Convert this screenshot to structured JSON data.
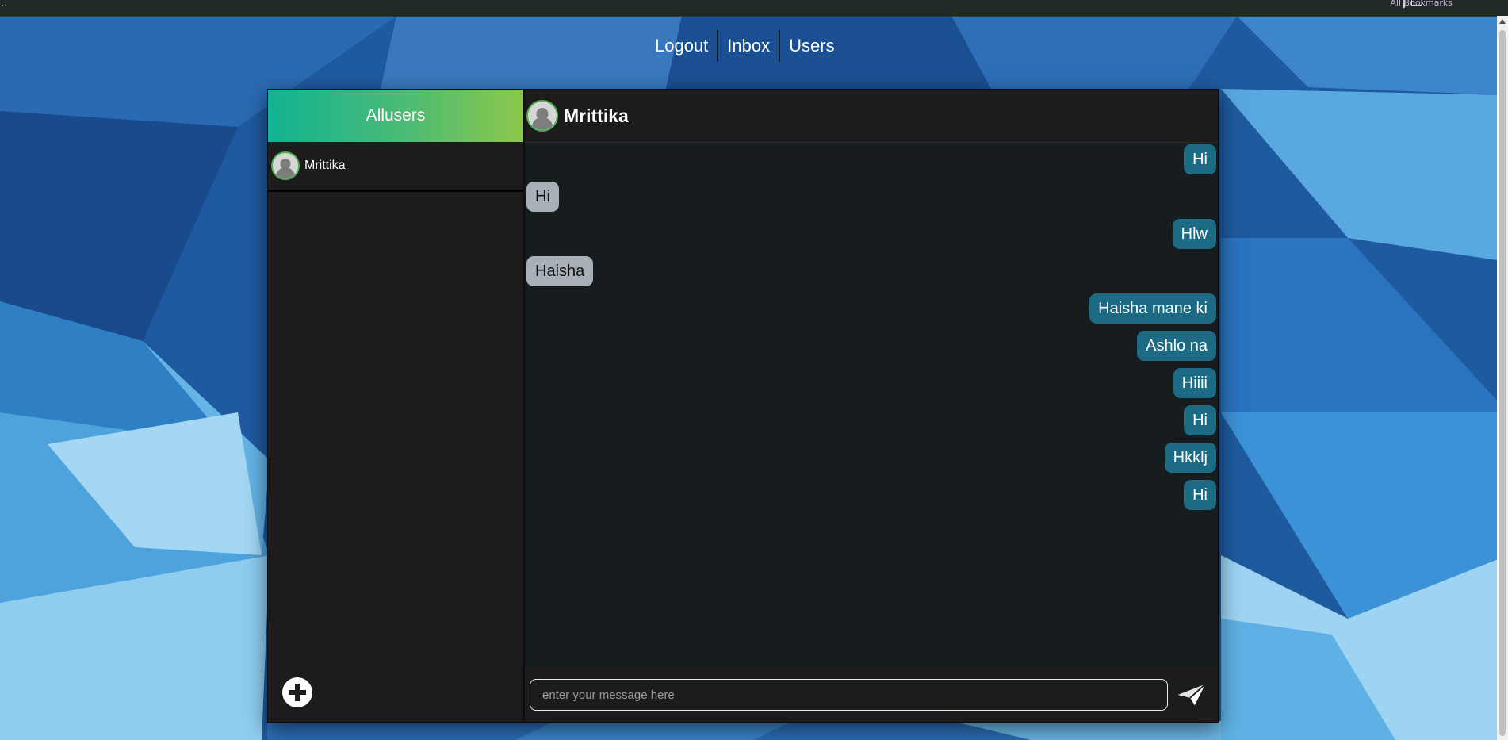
{
  "browser": {
    "bookmarks_label": "All Bookmarks"
  },
  "nav": {
    "items": [
      {
        "label": "Logout"
      },
      {
        "label": "Inbox"
      },
      {
        "label": "Users"
      }
    ]
  },
  "sidebar": {
    "header": "Allusers",
    "users": [
      {
        "name": "Mrittika",
        "icon": "user-avatar-icon"
      }
    ],
    "add_icon": "plus-circle-icon"
  },
  "chat": {
    "contact_name": "Mrittika",
    "messages": [
      {
        "text": "Hi",
        "direction": "outgoing"
      },
      {
        "text": "Hi",
        "direction": "incoming"
      },
      {
        "text": "Hlw",
        "direction": "outgoing"
      },
      {
        "text": "Haisha",
        "direction": "incoming"
      },
      {
        "text": "Haisha mane ki",
        "direction": "outgoing"
      },
      {
        "text": "Ashlo na",
        "direction": "outgoing"
      },
      {
        "text": "Hiiii",
        "direction": "outgoing"
      },
      {
        "text": "Hi",
        "direction": "outgoing"
      },
      {
        "text": "Hkklj",
        "direction": "outgoing"
      },
      {
        "text": "Hi",
        "direction": "outgoing"
      }
    ],
    "input_placeholder": "enter your message here",
    "send_icon": "paper-plane-icon"
  },
  "colors": {
    "sidebar_header_gradient_start": "#11b392",
    "sidebar_header_gradient_end": "#8cc84a",
    "outgoing_bubble": "#1d6a85",
    "incoming_bubble": "#a7b0b7",
    "panel_bg": "#1e1b1c",
    "messages_bg": "#171c1e"
  }
}
